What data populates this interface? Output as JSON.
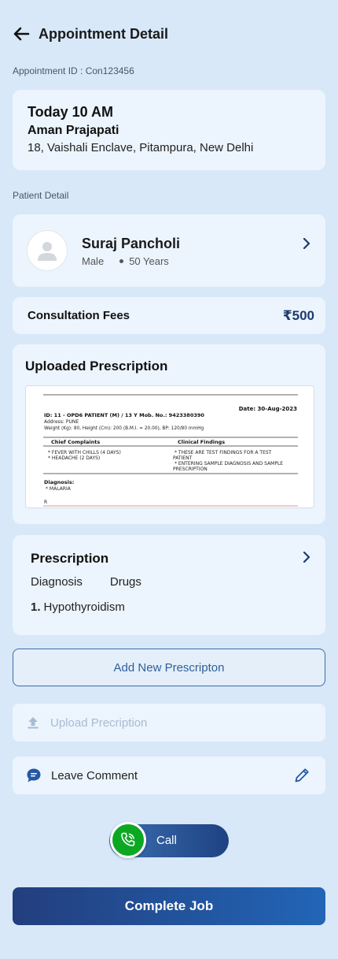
{
  "header": {
    "title": "Appointment Detail",
    "back_icon": "arrow-left-icon"
  },
  "appointment": {
    "id_label": "Appointment ID : Con123456",
    "time": "Today  10 AM",
    "name": "Aman Prajapati",
    "address": "18, Vaishali Enclave, Pitampura, New Delhi"
  },
  "patient": {
    "section_label": "Patient Detail",
    "name": "Suraj Pancholi",
    "gender": "Male",
    "age": "50 Years"
  },
  "fees": {
    "label": "Consultation Fees",
    "value": "₹500"
  },
  "uploaded": {
    "title": "Uploaded Prescription",
    "doc": {
      "date": "Date: 30-Aug-2023",
      "id_line": "ID: 11 - OPD6 PATIENT (M)  / 13 Y   Mob. No.: 9423380390",
      "address": "Address: PUNE",
      "vitals": "Weight (Kg): 80, Height (Cm): 200 (B.M.I. = 20.00), BP: 120/80 mmHg",
      "col_left": "Chief Complaints",
      "col_right": "Clinical Findings",
      "complaint_1": "* FEVER WITH CHILLS (4 DAYS)",
      "complaint_2": "* HEADACHE (2 DAYS)",
      "finding_1": "* THESE ARE TEST FINDINGS FOR A TEST",
      "finding_1b": "PATIENT",
      "finding_2": "* ENTERING SAMPLE DIAGNOSIS AND SAMPLE",
      "finding_2b": "PRESCRIPTION",
      "diagnosis_label": "Diagnosis:",
      "diagnosis": "* MALARIA",
      "rx": "R"
    }
  },
  "prescription": {
    "title": "Prescription",
    "col_1": "Diagnosis",
    "col_2": "Drugs",
    "item_num": "1.",
    "item_text": "Hypothyroidism"
  },
  "actions": {
    "add": "Add New Prescripton",
    "upload": "Upload Precription",
    "comment": "Leave Comment",
    "call": "Call",
    "complete": "Complete Job"
  },
  "colors": {
    "background": "#d8e8f8",
    "card": "#ecf4fd",
    "primary": "#1e3a6e",
    "call_green": "#0ca824"
  }
}
